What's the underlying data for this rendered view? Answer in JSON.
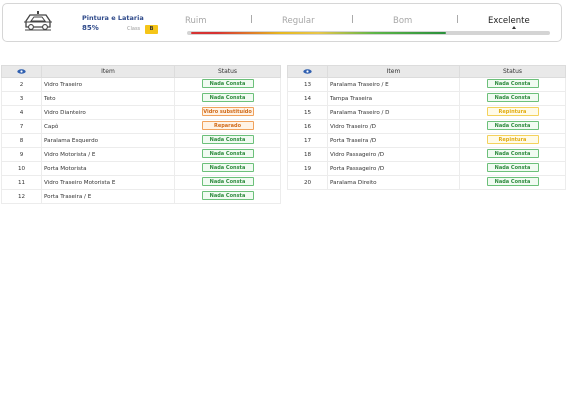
{
  "header": {
    "icon": "car-body-icon",
    "category": "Pintura e Lataria",
    "percent": "85%",
    "class_label": "Class",
    "class_value": "B",
    "scale": [
      "Ruim",
      "Regular",
      "Bom",
      "Excelente"
    ],
    "active_level": "Excelente",
    "progress_fraction": 0.7,
    "colors": {
      "red": "#d63232",
      "yellow": "#e6b820",
      "green": "#2a8f3c",
      "brand": "#2f4a8a"
    }
  },
  "columns": {
    "icon": "eye-icon",
    "item": "Item",
    "status": "Status"
  },
  "left": [
    {
      "n": "2",
      "item": "Vidro Traseiro",
      "status": "Nada Consta",
      "kind": "ok"
    },
    {
      "n": "3",
      "item": "Teto",
      "status": "Nada Consta",
      "kind": "ok"
    },
    {
      "n": "4",
      "item": "Vidro Dianteiro",
      "status": "Vidro substituído",
      "kind": "warn"
    },
    {
      "n": "7",
      "item": "Capô",
      "status": "Reparado",
      "kind": "warn"
    },
    {
      "n": "8",
      "item": "Paralama Esquerdo",
      "status": "Nada Consta",
      "kind": "ok"
    },
    {
      "n": "9",
      "item": "Vidro Motorista / E",
      "status": "Nada Consta",
      "kind": "ok"
    },
    {
      "n": "10",
      "item": "Porta Motorista",
      "status": "Nada Consta",
      "kind": "ok"
    },
    {
      "n": "11",
      "item": "Vidro Traseiro Motorista E",
      "status": "Nada Consta",
      "kind": "ok"
    },
    {
      "n": "12",
      "item": "Porta Traseira / E",
      "status": "Nada Consta",
      "kind": "ok"
    }
  ],
  "right": [
    {
      "n": "13",
      "item": "Paralama Traseiro / E",
      "status": "Nada Consta",
      "kind": "ok"
    },
    {
      "n": "14",
      "item": "Tampa Traseira",
      "status": "Nada Consta",
      "kind": "ok"
    },
    {
      "n": "15",
      "item": "Paralama Traseiro / D",
      "status": "Repintura",
      "kind": "yellow"
    },
    {
      "n": "16",
      "item": "Vidro Traseiro /D",
      "status": "Nada Consta",
      "kind": "ok"
    },
    {
      "n": "17",
      "item": "Porta Traseira /D",
      "status": "Repintura",
      "kind": "yellow"
    },
    {
      "n": "18",
      "item": "Vidro Passageiro /D",
      "status": "Nada Consta",
      "kind": "ok"
    },
    {
      "n": "19",
      "item": "Porta Passageiro /D",
      "status": "Nada Consta",
      "kind": "ok"
    },
    {
      "n": "20",
      "item": "Paralama Direito",
      "status": "Nada Consta",
      "kind": "ok"
    }
  ]
}
